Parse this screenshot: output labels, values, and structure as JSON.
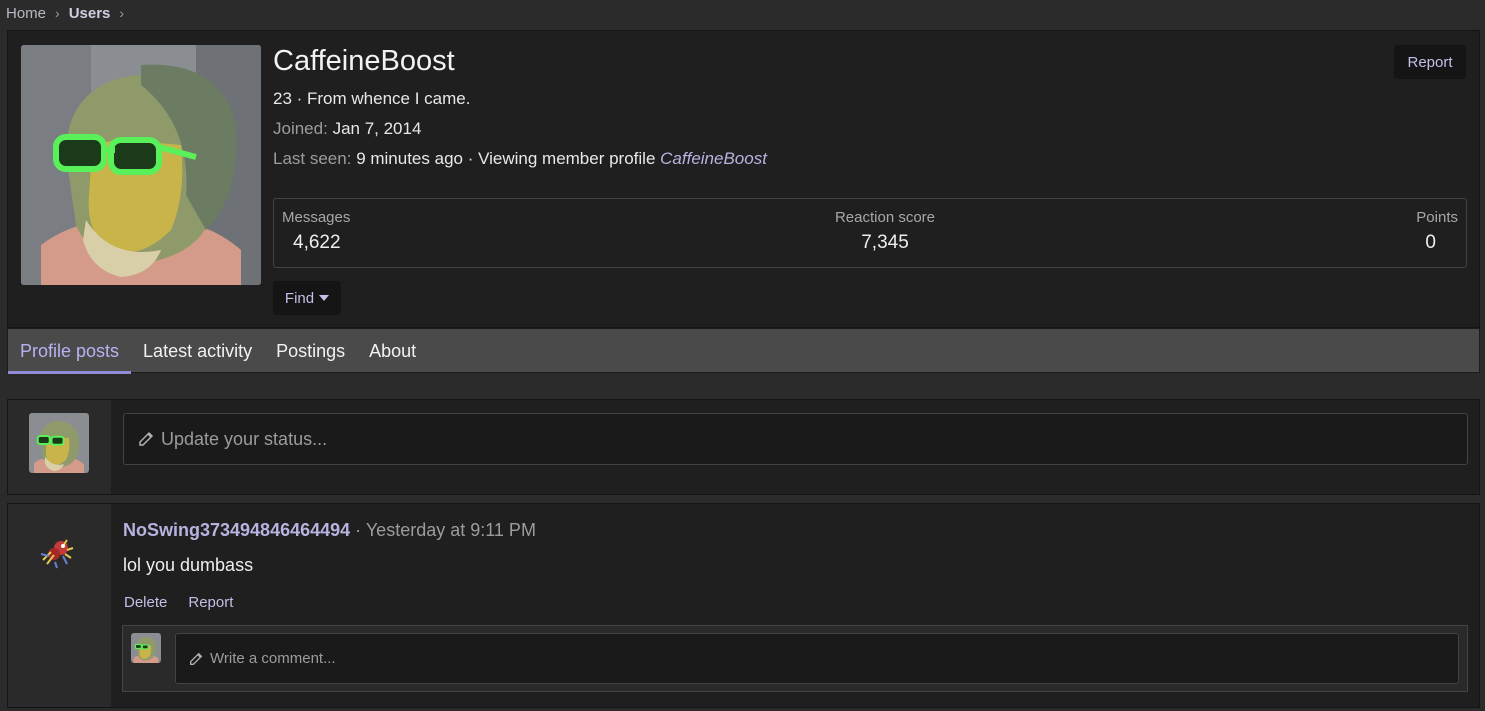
{
  "breadcrumb": {
    "items": [
      "Home",
      "Users"
    ]
  },
  "profile": {
    "username": "CaffeineBoost",
    "tagline": "23 · From whence I came.",
    "joined_label": "Joined:",
    "joined_value": "Jan 7, 2014",
    "last_seen_label": "Last seen:",
    "last_seen_value": "9 minutes ago · Viewing member profile",
    "last_seen_link": "CaffeineBoost",
    "report_label": "Report",
    "find_label": "Find",
    "stats": {
      "messages_label": "Messages",
      "messages_value": "4,622",
      "reaction_label": "Reaction score",
      "reaction_value": "7,345",
      "points_label": "Points",
      "points_value": "0"
    }
  },
  "tabs": [
    {
      "label": "Profile posts",
      "active": true
    },
    {
      "label": "Latest activity"
    },
    {
      "label": "Postings"
    },
    {
      "label": "About"
    }
  ],
  "status": {
    "placeholder": "Update your status..."
  },
  "post": {
    "author": "NoSwing373494846464494",
    "separator": " · ",
    "time": "Yesterday at 9:11 PM",
    "body": "lol you dumbass",
    "actions": {
      "delete_label": "Delete",
      "report_label": "Report"
    },
    "comment_placeholder": "Write a comment..."
  },
  "colors": {
    "accent": "#b7b3e0",
    "tab_underline": "#8f8bd6",
    "background": "#2b2b2b",
    "panel": "#1f1f1f"
  }
}
